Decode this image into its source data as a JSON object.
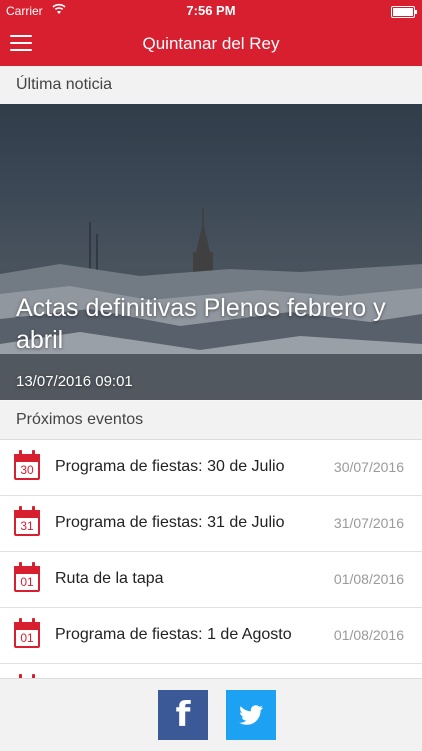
{
  "status_bar": {
    "carrier": "Carrier",
    "time": "7:56 PM"
  },
  "navbar": {
    "title": "Quintanar del Rey",
    "menu_icon": "hamburger-icon"
  },
  "latest_news": {
    "header": "Última noticia",
    "title": "Actas definitivas Plenos febrero y abril",
    "date": "13/07/2016 09:01"
  },
  "events": {
    "header": "Próximos eventos",
    "items": [
      {
        "day": "30",
        "title": "Programa de fiestas: 30 de Julio",
        "date": "30/07/2016"
      },
      {
        "day": "31",
        "title": "Programa de fiestas: 31 de Julio",
        "date": "31/07/2016"
      },
      {
        "day": "01",
        "title": "Ruta de la tapa",
        "date": "01/08/2016"
      },
      {
        "day": "01",
        "title": "Programa de fiestas: 1 de Agosto",
        "date": "01/08/2016"
      },
      {
        "day": "",
        "title": "",
        "date": ""
      }
    ]
  },
  "footer": {
    "facebook_icon": "facebook-icon",
    "twitter_icon": "twitter-icon"
  },
  "colors": {
    "brand": "#d71f30",
    "facebook": "#3b5997",
    "twitter": "#1da1f2"
  }
}
